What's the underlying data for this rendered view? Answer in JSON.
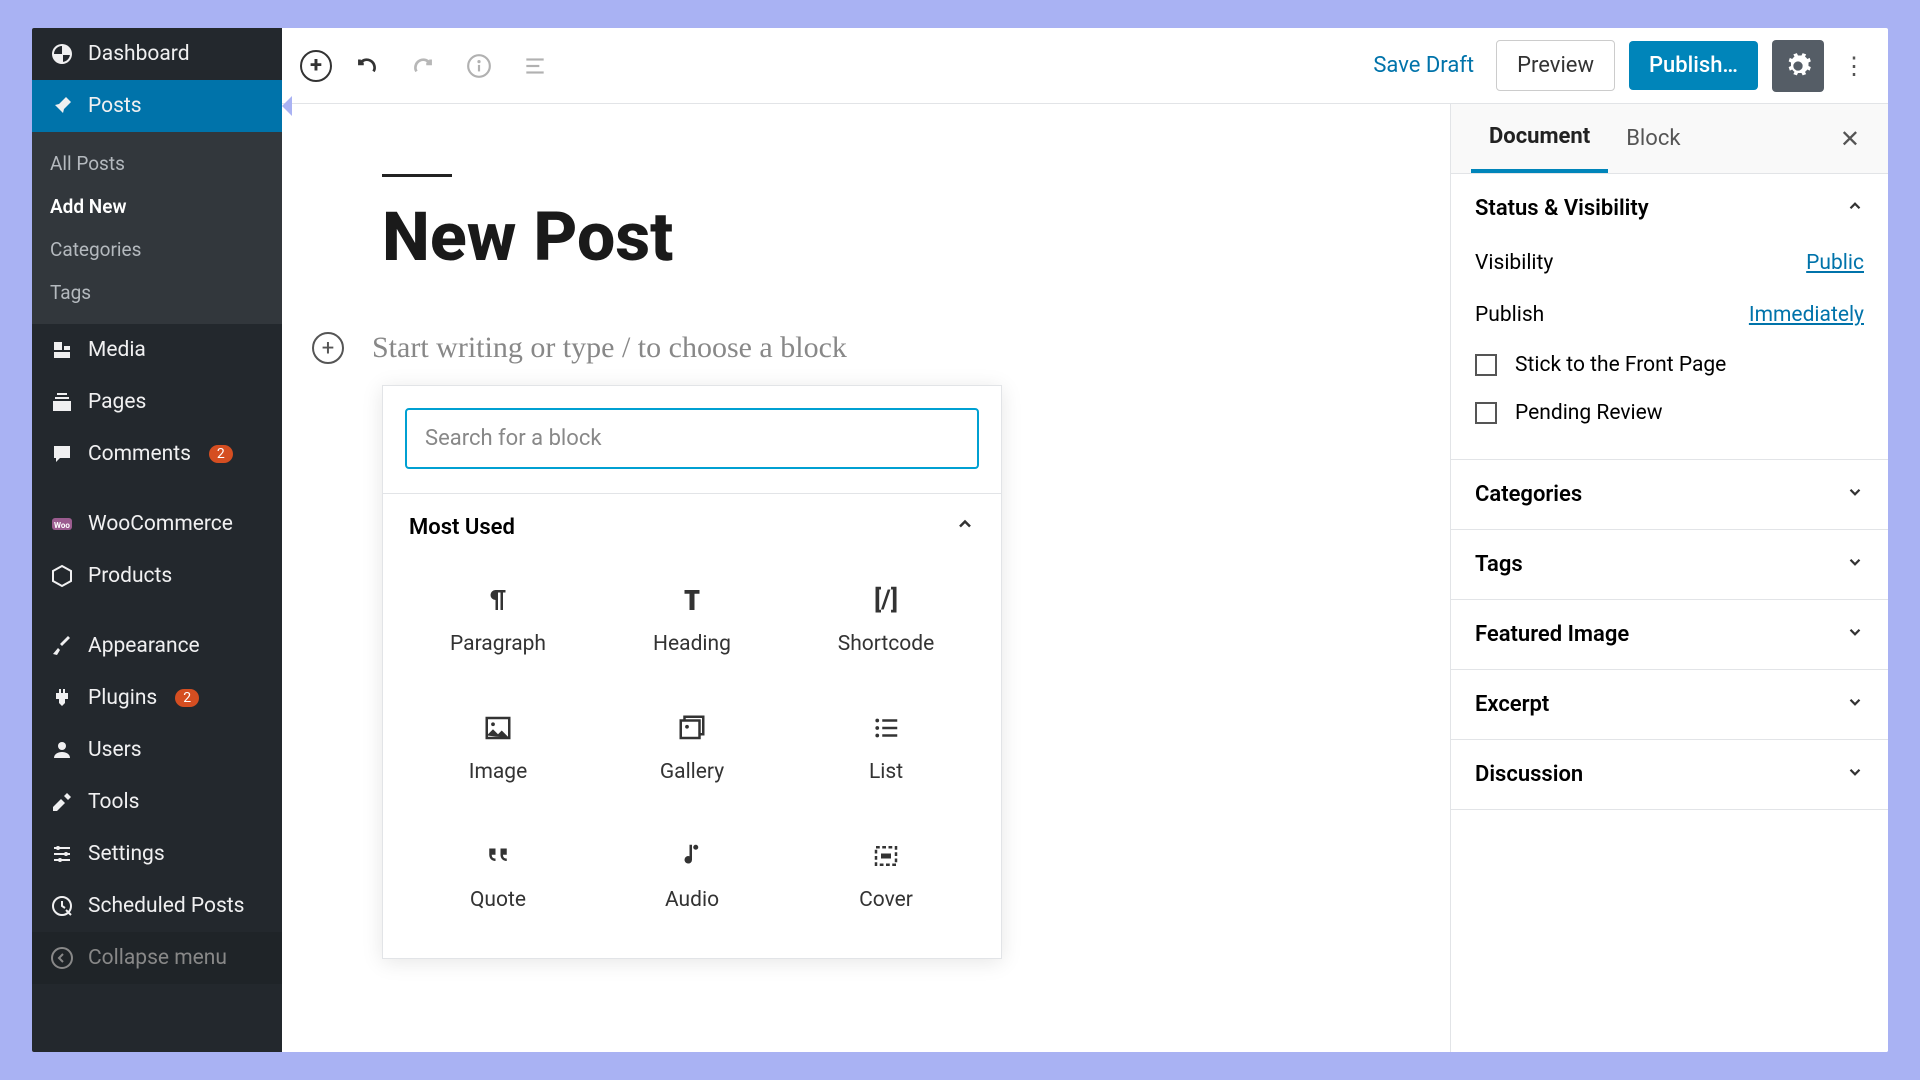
{
  "sidebar": {
    "dashboard": "Dashboard",
    "posts": "Posts",
    "posts_sub": {
      "all": "All Posts",
      "add": "Add New",
      "cat": "Categories",
      "tags": "Tags"
    },
    "media": "Media",
    "pages": "Pages",
    "comments": "Comments",
    "comments_badge": "2",
    "woocommerce": "WooCommerce",
    "products": "Products",
    "appearance": "Appearance",
    "plugins": "Plugins",
    "plugins_badge": "2",
    "users": "Users",
    "tools": "Tools",
    "settings": "Settings",
    "scheduled": "Scheduled Posts",
    "collapse": "Collapse menu"
  },
  "toolbar": {
    "save_draft": "Save Draft",
    "preview": "Preview",
    "publish": "Publish…"
  },
  "editor": {
    "title": "New Post",
    "placeholder": "Start writing or type / to choose a block",
    "search_placeholder": "Search for a block",
    "most_used": "Most Used",
    "blocks": {
      "paragraph": "Paragraph",
      "heading": "Heading",
      "shortcode": "Shortcode",
      "image": "Image",
      "gallery": "Gallery",
      "list": "List",
      "quote": "Quote",
      "audio": "Audio",
      "cover": "Cover"
    }
  },
  "inspector": {
    "tabs": {
      "document": "Document",
      "block": "Block"
    },
    "status": {
      "title": "Status & Visibility",
      "visibility_label": "Visibility",
      "visibility_value": "Public",
      "publish_label": "Publish",
      "publish_value": "Immediately",
      "stick": "Stick to the Front Page",
      "pending": "Pending Review"
    },
    "categories": "Categories",
    "tags": "Tags",
    "featured": "Featured Image",
    "excerpt": "Excerpt",
    "discussion": "Discussion"
  }
}
